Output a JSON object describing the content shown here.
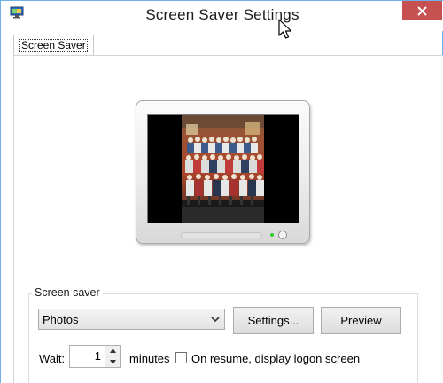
{
  "window": {
    "title": "Screen Saver Settings"
  },
  "icons": {
    "app": "display-properties-icon",
    "close": "close-icon",
    "cursor": "mouse-pointer-icon",
    "dropdown": "chevron-down-icon",
    "spin_up": "spin-up-icon",
    "spin_down": "spin-down-icon"
  },
  "colors": {
    "close_button": "#c75050",
    "window_border": "#6fb0e6",
    "power_led": "#33cc33"
  },
  "tabs": [
    {
      "label": "Screen Saver",
      "selected": true
    }
  ],
  "preview": {
    "description_kind": "monitor-preview-with-photo"
  },
  "screensaver": {
    "group_label": "Screen saver",
    "selected": "Photos",
    "settings_label": "Settings...",
    "preview_label": "Preview",
    "wait_label": "Wait:",
    "wait_value": "1",
    "minutes_label": "minutes",
    "logon_checkbox_label": "On resume, display logon screen",
    "logon_checked": false
  }
}
